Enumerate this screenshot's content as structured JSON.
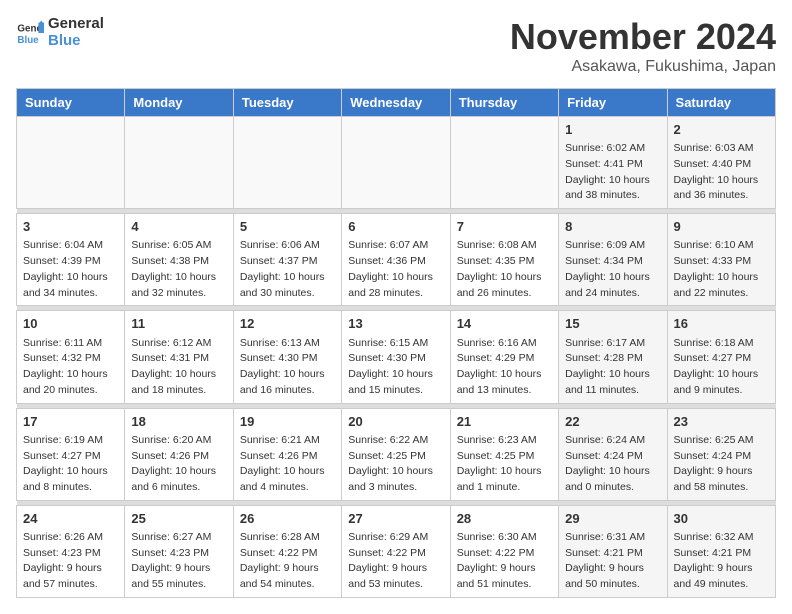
{
  "logo": {
    "general": "General",
    "blue": "Blue"
  },
  "header": {
    "title": "November 2024",
    "subtitle": "Asakawa, Fukushima, Japan"
  },
  "weekdays": [
    "Sunday",
    "Monday",
    "Tuesday",
    "Wednesday",
    "Thursday",
    "Friday",
    "Saturday"
  ],
  "weeks": [
    [
      {
        "day": "",
        "info": ""
      },
      {
        "day": "",
        "info": ""
      },
      {
        "day": "",
        "info": ""
      },
      {
        "day": "",
        "info": ""
      },
      {
        "day": "",
        "info": ""
      },
      {
        "day": "1",
        "info": "Sunrise: 6:02 AM\nSunset: 4:41 PM\nDaylight: 10 hours\nand 38 minutes."
      },
      {
        "day": "2",
        "info": "Sunrise: 6:03 AM\nSunset: 4:40 PM\nDaylight: 10 hours\nand 36 minutes."
      }
    ],
    [
      {
        "day": "3",
        "info": "Sunrise: 6:04 AM\nSunset: 4:39 PM\nDaylight: 10 hours\nand 34 minutes."
      },
      {
        "day": "4",
        "info": "Sunrise: 6:05 AM\nSunset: 4:38 PM\nDaylight: 10 hours\nand 32 minutes."
      },
      {
        "day": "5",
        "info": "Sunrise: 6:06 AM\nSunset: 4:37 PM\nDaylight: 10 hours\nand 30 minutes."
      },
      {
        "day": "6",
        "info": "Sunrise: 6:07 AM\nSunset: 4:36 PM\nDaylight: 10 hours\nand 28 minutes."
      },
      {
        "day": "7",
        "info": "Sunrise: 6:08 AM\nSunset: 4:35 PM\nDaylight: 10 hours\nand 26 minutes."
      },
      {
        "day": "8",
        "info": "Sunrise: 6:09 AM\nSunset: 4:34 PM\nDaylight: 10 hours\nand 24 minutes."
      },
      {
        "day": "9",
        "info": "Sunrise: 6:10 AM\nSunset: 4:33 PM\nDaylight: 10 hours\nand 22 minutes."
      }
    ],
    [
      {
        "day": "10",
        "info": "Sunrise: 6:11 AM\nSunset: 4:32 PM\nDaylight: 10 hours\nand 20 minutes."
      },
      {
        "day": "11",
        "info": "Sunrise: 6:12 AM\nSunset: 4:31 PM\nDaylight: 10 hours\nand 18 minutes."
      },
      {
        "day": "12",
        "info": "Sunrise: 6:13 AM\nSunset: 4:30 PM\nDaylight: 10 hours\nand 16 minutes."
      },
      {
        "day": "13",
        "info": "Sunrise: 6:15 AM\nSunset: 4:30 PM\nDaylight: 10 hours\nand 15 minutes."
      },
      {
        "day": "14",
        "info": "Sunrise: 6:16 AM\nSunset: 4:29 PM\nDaylight: 10 hours\nand 13 minutes."
      },
      {
        "day": "15",
        "info": "Sunrise: 6:17 AM\nSunset: 4:28 PM\nDaylight: 10 hours\nand 11 minutes."
      },
      {
        "day": "16",
        "info": "Sunrise: 6:18 AM\nSunset: 4:27 PM\nDaylight: 10 hours\nand 9 minutes."
      }
    ],
    [
      {
        "day": "17",
        "info": "Sunrise: 6:19 AM\nSunset: 4:27 PM\nDaylight: 10 hours\nand 8 minutes."
      },
      {
        "day": "18",
        "info": "Sunrise: 6:20 AM\nSunset: 4:26 PM\nDaylight: 10 hours\nand 6 minutes."
      },
      {
        "day": "19",
        "info": "Sunrise: 6:21 AM\nSunset: 4:26 PM\nDaylight: 10 hours\nand 4 minutes."
      },
      {
        "day": "20",
        "info": "Sunrise: 6:22 AM\nSunset: 4:25 PM\nDaylight: 10 hours\nand 3 minutes."
      },
      {
        "day": "21",
        "info": "Sunrise: 6:23 AM\nSunset: 4:25 PM\nDaylight: 10 hours\nand 1 minute."
      },
      {
        "day": "22",
        "info": "Sunrise: 6:24 AM\nSunset: 4:24 PM\nDaylight: 10 hours\nand 0 minutes."
      },
      {
        "day": "23",
        "info": "Sunrise: 6:25 AM\nSunset: 4:24 PM\nDaylight: 9 hours\nand 58 minutes."
      }
    ],
    [
      {
        "day": "24",
        "info": "Sunrise: 6:26 AM\nSunset: 4:23 PM\nDaylight: 9 hours\nand 57 minutes."
      },
      {
        "day": "25",
        "info": "Sunrise: 6:27 AM\nSunset: 4:23 PM\nDaylight: 9 hours\nand 55 minutes."
      },
      {
        "day": "26",
        "info": "Sunrise: 6:28 AM\nSunset: 4:22 PM\nDaylight: 9 hours\nand 54 minutes."
      },
      {
        "day": "27",
        "info": "Sunrise: 6:29 AM\nSunset: 4:22 PM\nDaylight: 9 hours\nand 53 minutes."
      },
      {
        "day": "28",
        "info": "Sunrise: 6:30 AM\nSunset: 4:22 PM\nDaylight: 9 hours\nand 51 minutes."
      },
      {
        "day": "29",
        "info": "Sunrise: 6:31 AM\nSunset: 4:21 PM\nDaylight: 9 hours\nand 50 minutes."
      },
      {
        "day": "30",
        "info": "Sunrise: 6:32 AM\nSunset: 4:21 PM\nDaylight: 9 hours\nand 49 minutes."
      }
    ]
  ]
}
